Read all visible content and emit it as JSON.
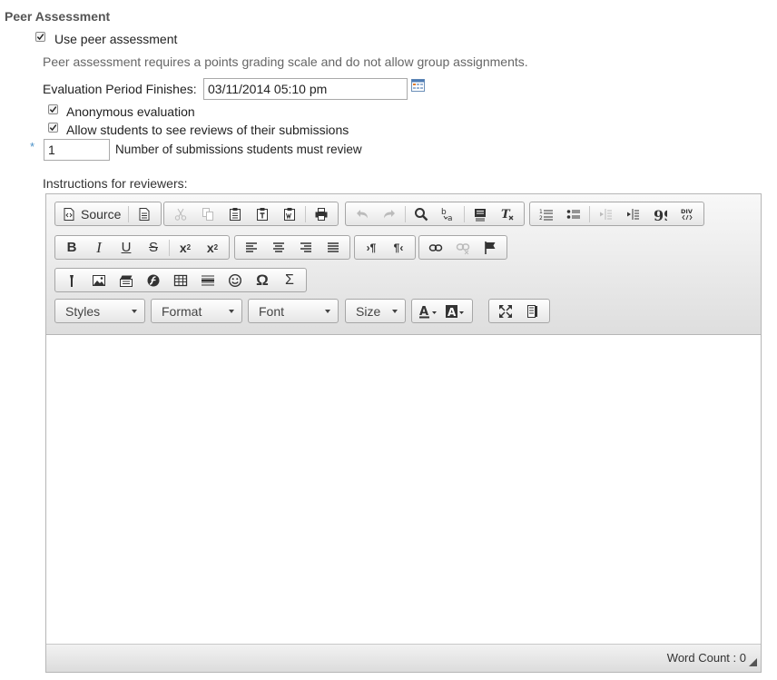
{
  "section": {
    "title": "Peer Assessment"
  },
  "use_peer": {
    "label": "Use peer assessment",
    "checked": true
  },
  "note": "Peer assessment requires a points grading scale and do not allow group assignments.",
  "eval_period": {
    "label": "Evaluation Period Finishes:",
    "value": "03/11/2014 05:10 pm",
    "icon": "calendar-icon"
  },
  "anonymous": {
    "label": "Anonymous evaluation",
    "checked": true
  },
  "allow_see": {
    "label": "Allow students to see reviews of their submissions",
    "checked": true
  },
  "num_reviews": {
    "required_mark": "*",
    "value": "1",
    "label": "Number of submissions students must review"
  },
  "instructions_label": "Instructions for reviewers:",
  "editor": {
    "source_label": "Source",
    "combos": {
      "styles": "Styles",
      "format": "Format",
      "font": "Font",
      "size": "Size"
    },
    "word_count": "Word Count : 0"
  }
}
